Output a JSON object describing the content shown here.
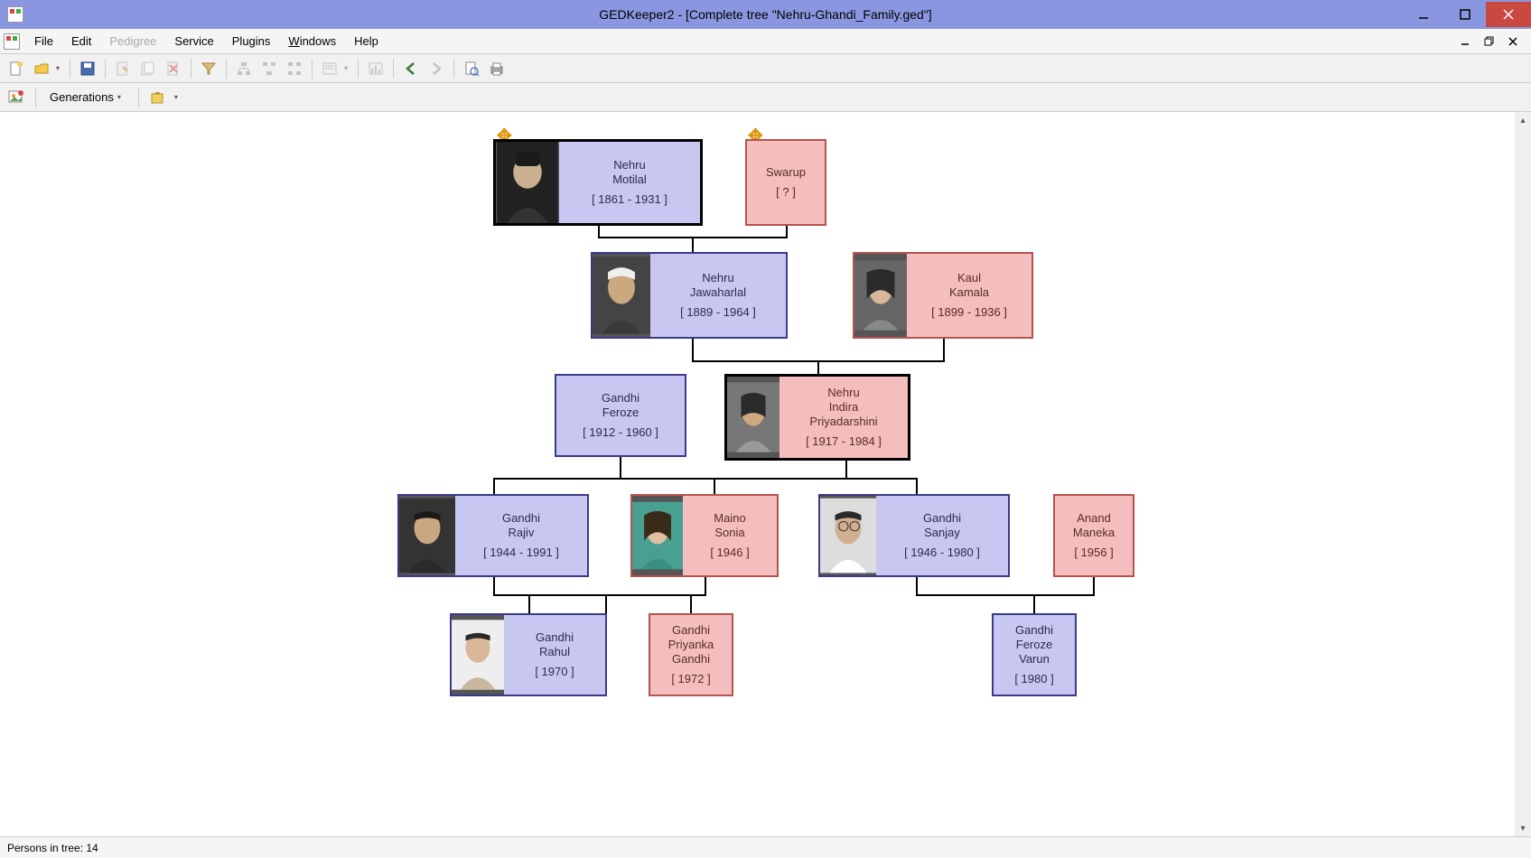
{
  "title": "GEDKeeper2 - [Complete tree \"Nehru-Ghandi_Family.ged\"]",
  "menu": {
    "file": "File",
    "edit": "Edit",
    "pedigree": "Pedigree",
    "service": "Service",
    "plugins": "Plugins",
    "windows": "Windows",
    "help": "Help"
  },
  "toolbar2": {
    "generations": "Generations"
  },
  "status": "Persons in tree: 14",
  "nodes": {
    "motilal": {
      "name1": "Nehru",
      "name2": "Motilal",
      "dates": "[ 1861 - 1931 ]"
    },
    "swarup": {
      "name1": "Swarup",
      "dates": "[ ? ]"
    },
    "jawaharlal": {
      "name1": "Nehru",
      "name2": "Jawaharlal",
      "dates": "[ 1889 - 1964 ]"
    },
    "kamala": {
      "name1": "Kaul",
      "name2": "Kamala",
      "dates": "[ 1899 - 1936 ]"
    },
    "feroze": {
      "name1": "Gandhi",
      "name2": "Feroze",
      "dates": "[ 1912 - 1960 ]"
    },
    "indira": {
      "name1": "Nehru",
      "name2": "Indira",
      "name3": "Priyadarshini",
      "dates": "[ 1917 - 1984 ]"
    },
    "rajiv": {
      "name1": "Gandhi",
      "name2": "Rajiv",
      "dates": "[ 1944 - 1991 ]"
    },
    "sonia": {
      "name1": "Maino",
      "name2": "Sonia",
      "dates": "[ 1946 ]"
    },
    "sanjay": {
      "name1": "Gandhi",
      "name2": "Sanjay",
      "dates": "[ 1946 - 1980 ]"
    },
    "maneka": {
      "name1": "Anand",
      "name2": "Maneka",
      "dates": "[ 1956 ]"
    },
    "rahul": {
      "name1": "Gandhi",
      "name2": "Rahul",
      "dates": "[ 1970 ]"
    },
    "priyanka": {
      "name1": "Gandhi",
      "name2": "Priyanka",
      "name3": "Gandhi",
      "dates": "[ 1972 ]"
    },
    "varun": {
      "name1": "Gandhi",
      "name2": "Feroze",
      "name3": "Varun",
      "dates": "[ 1980 ]"
    }
  }
}
